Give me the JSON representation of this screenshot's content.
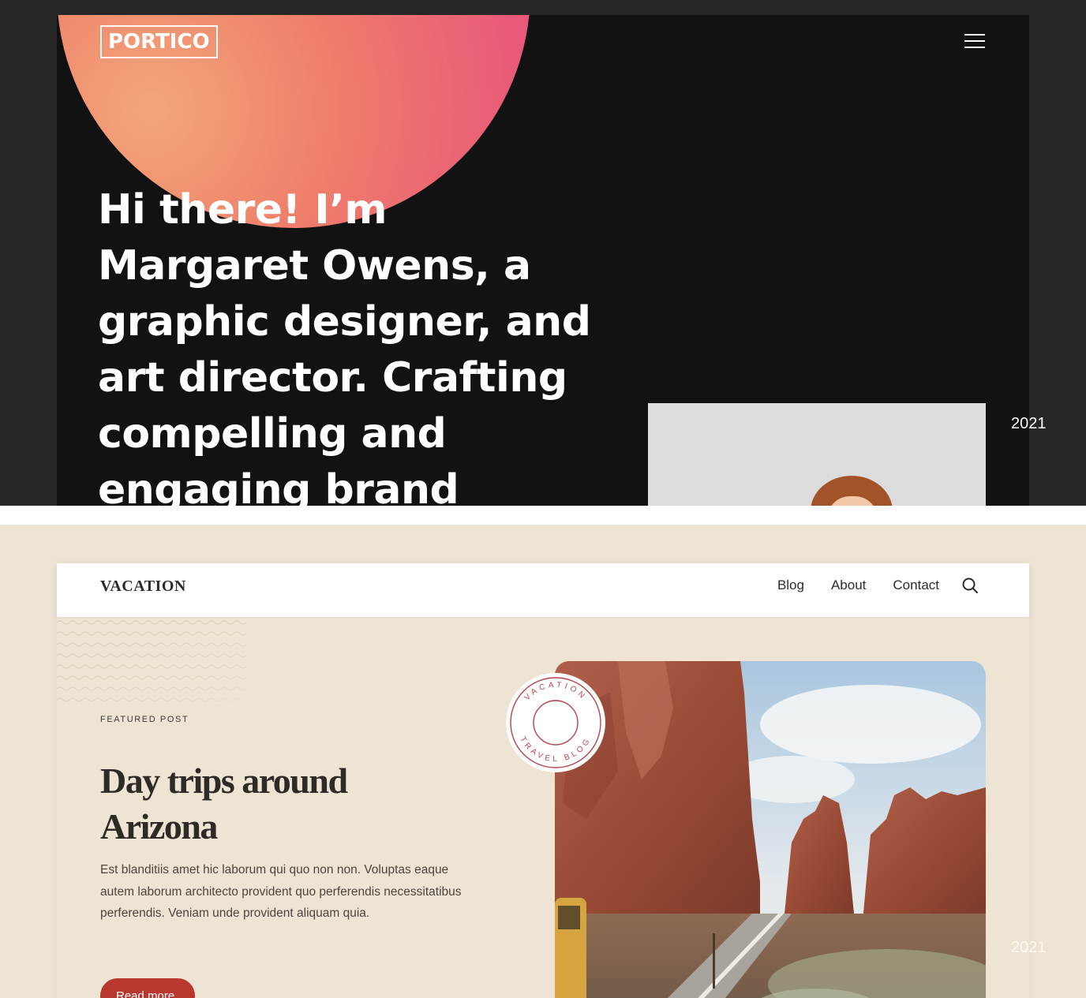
{
  "portico": {
    "logo": "PORTICO",
    "menu_icon": "hamburger-menu-icon",
    "hero_text": "Hi there! I’m Margaret Owens, a graphic designer, and art director. Crafting compelling and engaging brand",
    "year": "2021",
    "colors": {
      "background": "#121212",
      "sun_start": "#f3a77a",
      "sun_end": "#e3457f"
    }
  },
  "vacation": {
    "logo": "VACATION",
    "nav": [
      {
        "label": "Blog"
      },
      {
        "label": "About"
      },
      {
        "label": "Contact"
      }
    ],
    "search_icon": "search-icon",
    "featured_label": "FEATURED POST",
    "post_title": "Day trips around Arizona",
    "post_excerpt": "Est blanditiis amet hic laborum qui quo non non. Voluptas eaque autem laborum architecto provident quo perferendis necessitatibus perferendis. Veniam unde provident aliquam quia.",
    "read_more": "Read more",
    "badge": {
      "top_text": "VACATION",
      "bottom_text": "TRAVEL BLOG"
    },
    "year": "2021",
    "colors": {
      "background": "#ede4d3",
      "accent": "#b8382f",
      "badge": "#b8424a"
    }
  }
}
